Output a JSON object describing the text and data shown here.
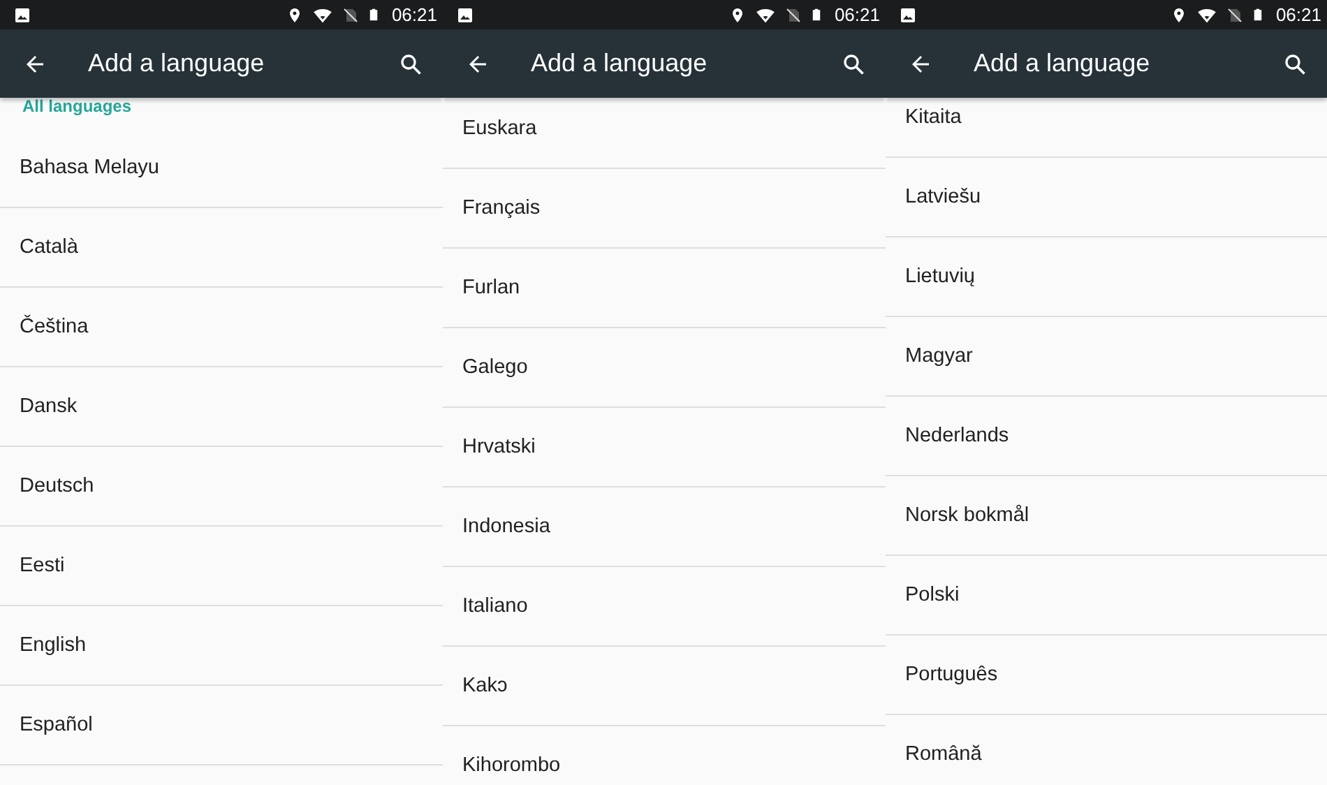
{
  "screens": [
    {
      "status_bar": {
        "time": "06:21"
      },
      "app_bar": {
        "title": "Add a language"
      },
      "section_header": "All languages",
      "languages": [
        "Bahasa Melayu",
        "Català",
        "Čeština",
        "Dansk",
        "Deutsch",
        "Eesti",
        "English",
        "Español"
      ]
    },
    {
      "status_bar": {
        "time": "06:21"
      },
      "app_bar": {
        "title": "Add a language"
      },
      "languages": [
        "Euskara",
        "Français",
        "Furlan",
        "Galego",
        "Hrvatski",
        "Indonesia",
        "Italiano",
        "Kakɔ",
        "Kihorombo"
      ]
    },
    {
      "status_bar": {
        "time": "06:21"
      },
      "app_bar": {
        "title": "Add a language"
      },
      "languages": [
        "Kitaita",
        "Latviešu",
        "Lietuvių",
        "Magyar",
        "Nederlands",
        "Norsk bokmål",
        "Polski",
        "Português",
        "Română"
      ]
    }
  ]
}
